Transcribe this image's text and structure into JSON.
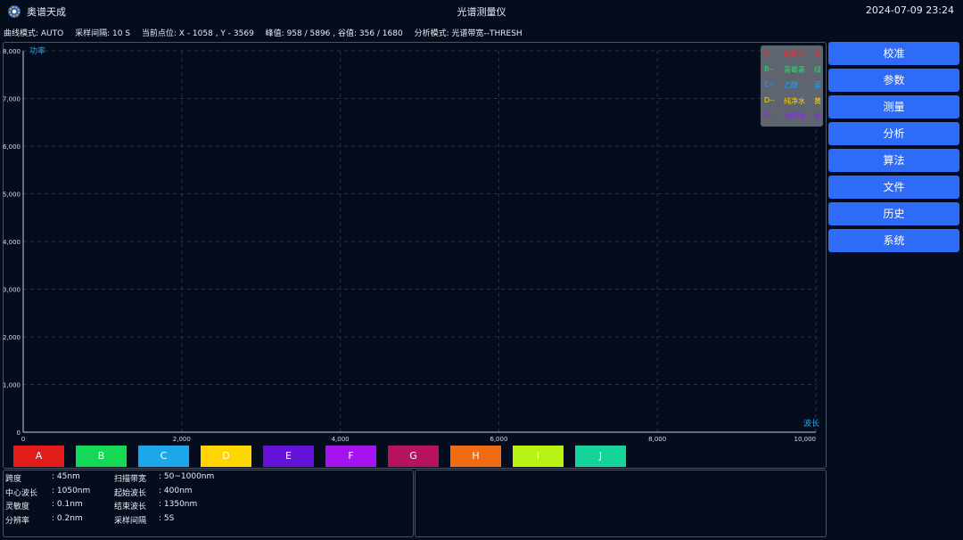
{
  "header": {
    "app_name": "奥谱天成",
    "title": "光谱测量仪",
    "datetime": "2024-07-09 23:24"
  },
  "status": {
    "curve_mode": "曲线模式: AUTO",
    "sample_interval": "采样间隔: 10 S",
    "cursor": "当前点位: X - 1058 , Y - 3569",
    "peak_valley": "峰值: 958 / 5896 , 谷值: 356 / 1680",
    "analysis_mode": "分析模式: 光谱带宽--THRESH"
  },
  "chart_data": {
    "type": "line",
    "ylabel": "功率",
    "xlabel": "波长",
    "xlim": [
      0,
      10000
    ],
    "ylim": [
      0,
      8000
    ],
    "x_ticks": [
      "0",
      "2,000",
      "4,000",
      "6,000",
      "8,000",
      "10,000"
    ],
    "y_ticks": [
      "0",
      "1,000",
      "2,000",
      "3,000",
      "4,000",
      "5,000",
      "6,000",
      "7,000",
      "8,000"
    ],
    "grid": true,
    "series": []
  },
  "legend": [
    {
      "key": "A--",
      "name": "胡萝卜",
      "color": "红",
      "hex": "#ff2a2a"
    },
    {
      "key": "B--",
      "name": "青霉素",
      "color": "绿",
      "hex": "#22e06a"
    },
    {
      "key": "C--",
      "name": "乙醇",
      "color": "蓝",
      "hex": "#1aa0ff"
    },
    {
      "key": "D--",
      "name": "纯净水",
      "color": "黄",
      "hex": "#ffd400"
    },
    {
      "key": "E--",
      "name": "食用油",
      "color": "紫",
      "hex": "#8a2be2"
    }
  ],
  "channels": [
    {
      "label": "A",
      "color": "#e21b1b"
    },
    {
      "label": "B",
      "color": "#14d956"
    },
    {
      "label": "C",
      "color": "#1ba7e8"
    },
    {
      "label": "D",
      "color": "#ffd600"
    },
    {
      "label": "E",
      "color": "#6413d6"
    },
    {
      "label": "F",
      "color": "#a413f2"
    },
    {
      "label": "G",
      "color": "#b5125f"
    },
    {
      "label": "H",
      "color": "#f06b12"
    },
    {
      "label": "I",
      "color": "#b7f414"
    },
    {
      "label": "J",
      "color": "#14d49a"
    }
  ],
  "nav": [
    "校准",
    "参数",
    "测量",
    "分析",
    "算法",
    "文件",
    "历史",
    "系统"
  ],
  "info_left": {
    "col1": [
      {
        "label": "跨度",
        "value": ": 45nm"
      },
      {
        "label": "中心波长",
        "value": ": 1050nm"
      },
      {
        "label": "灵敏度",
        "value": ": 0.1nm"
      },
      {
        "label": "分辨率",
        "value": ": 0.2nm"
      }
    ],
    "col2": [
      {
        "label": "扫描带宽",
        "value": ": 50~1000nm"
      },
      {
        "label": "起始波长",
        "value": ": 400nm"
      },
      {
        "label": "结束波长",
        "value": ": 1350nm"
      },
      {
        "label": "采样间隔",
        "value": ": 5S"
      }
    ]
  },
  "colors": {
    "background": "#050d1c",
    "panel_border": "#4a5467",
    "nav_button": "#2e6bf6",
    "axis_label": "#3aa0e0",
    "grid": "#2a3344",
    "legend_bg": "#5e6570"
  }
}
